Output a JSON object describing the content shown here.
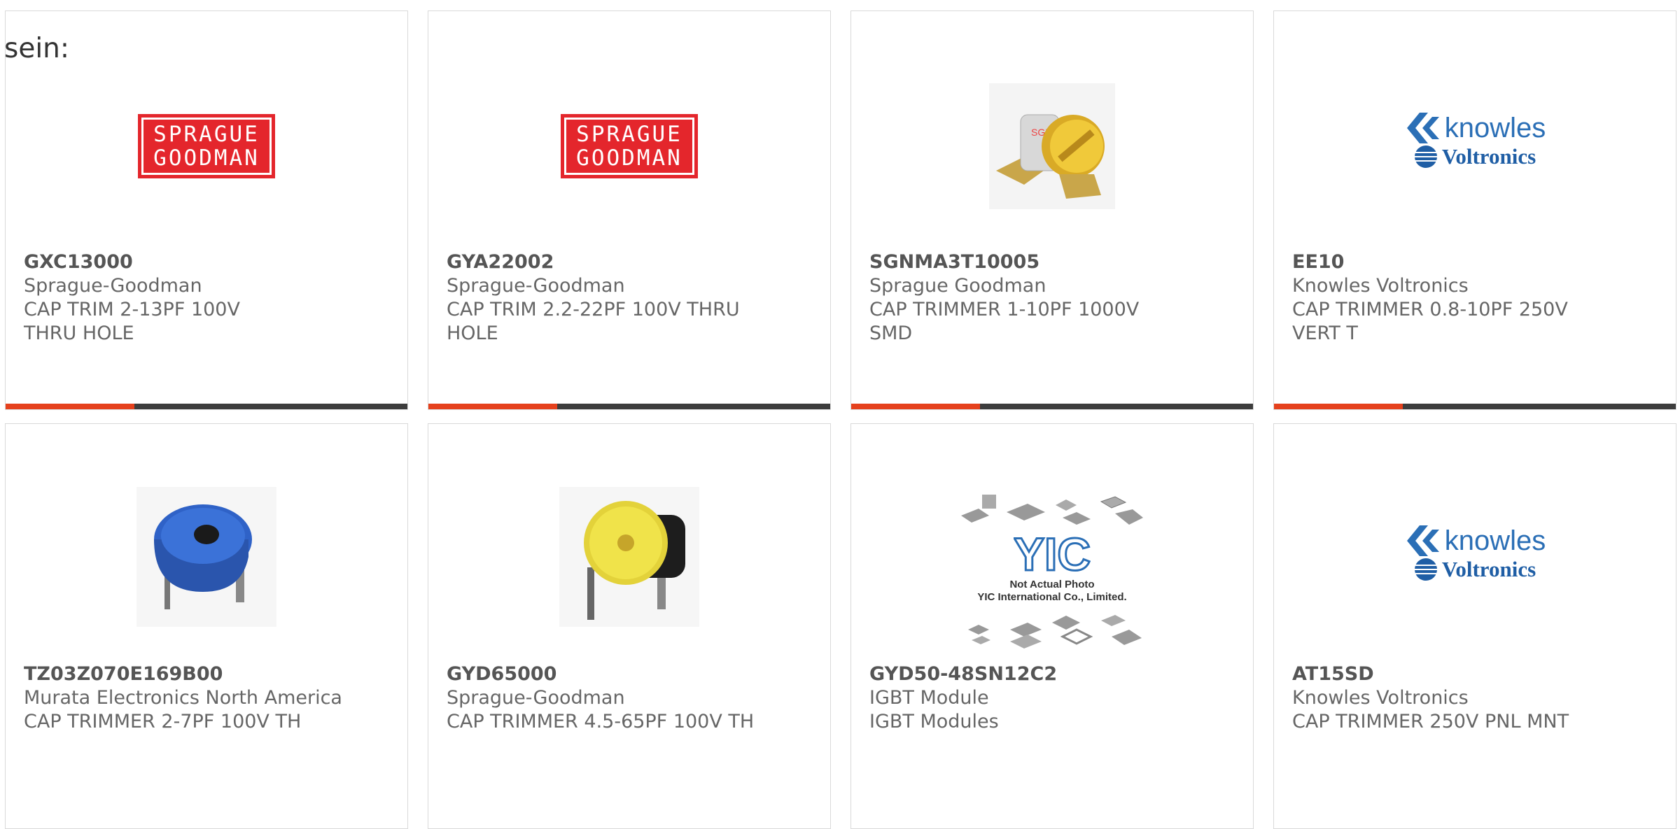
{
  "intro_text": "sein:",
  "colors": {
    "accent": "#e5411d",
    "bar": "#3d3d3d",
    "brand_red": "#e4262c",
    "knowles_blue": "#2b6fb6"
  },
  "cards": [
    {
      "part_number": "GXC13000",
      "manufacturer": "Sprague-Goodman",
      "description": "CAP TRIM 2-13PF 100V THRU HOLE",
      "image": "sprague-goodman-logo",
      "logo_line1": "SPRAGUE",
      "logo_line2": "GOODMAN"
    },
    {
      "part_number": "GYA22002",
      "manufacturer": "Sprague-Goodman",
      "description": "CAP TRIM 2.2-22PF 100V THRU HOLE",
      "image": "sprague-goodman-logo",
      "logo_line1": "SPRAGUE",
      "logo_line2": "GOODMAN"
    },
    {
      "part_number": "SGNMA3T10005",
      "manufacturer": "Sprague Goodman",
      "description": "CAP TRIMMER 1-10PF 1000V SMD",
      "image": "gold-trimmer-photo",
      "label": "SGF"
    },
    {
      "part_number": "EE10",
      "manufacturer": "Knowles Voltronics",
      "description": "CAP TRIMMER 0.8-10PF 250V VERT T",
      "image": "knowles-voltronics-logo",
      "logo_line1": "knowles",
      "logo_line2": "Voltronics"
    },
    {
      "part_number": "TZ03Z070E169B00",
      "manufacturer": "Murata Electronics North America",
      "description": "CAP TRIMMER 2-7PF 100V TH",
      "image": "blue-trimmer-photo"
    },
    {
      "part_number": "GYD65000",
      "manufacturer": "Sprague-Goodman",
      "description": "CAP TRIMMER 4.5-65PF 100V TH",
      "image": "yellow-trimmer-photo"
    },
    {
      "part_number": "GYD50-48SN12C2",
      "manufacturer": "IGBT Module",
      "description": "IGBT Modules",
      "image": "yic-placeholder",
      "logo_text": "YIC",
      "note_line1": "Not Actual Photo",
      "note_line2": "YIC International Co., Limited."
    },
    {
      "part_number": "AT15SD",
      "manufacturer": "Knowles Voltronics",
      "description": "CAP TRIMMER 250V PNL MNT",
      "image": "knowles-voltronics-logo",
      "logo_line1": "knowles",
      "logo_line2": "Voltronics"
    }
  ]
}
